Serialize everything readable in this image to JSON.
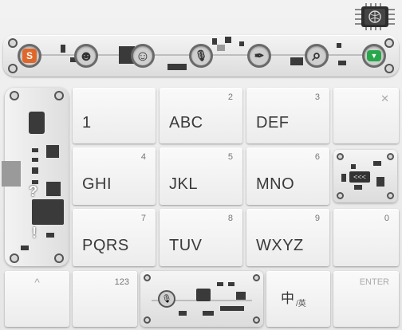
{
  "toolbar": {
    "buttons": [
      {
        "name": "logo",
        "glyph": "S",
        "color": "#e0672a"
      },
      {
        "name": "emoji",
        "glyph": "☻",
        "color": "#3b3b3b"
      },
      {
        "name": "sticker",
        "glyph": "☺",
        "color": "#3b3b3b"
      },
      {
        "name": "voice",
        "glyph": "🎙",
        "color": "#3b3b3b"
      },
      {
        "name": "handwriting",
        "glyph": "✒",
        "color": "#3b3b3b"
      },
      {
        "name": "search",
        "glyph": "⌕",
        "color": "#3b3b3b"
      },
      {
        "name": "collapse",
        "glyph": "▼",
        "color": "#27a84a"
      }
    ]
  },
  "keys": {
    "row1": [
      {
        "main": "1",
        "num": ""
      },
      {
        "main": "ABC",
        "num": "2"
      },
      {
        "main": "DEF",
        "num": "3"
      },
      {
        "main": "",
        "num": "✕"
      }
    ],
    "row2": [
      {
        "main": "GHI",
        "num": "4"
      },
      {
        "main": "JKL",
        "num": "5"
      },
      {
        "main": "MNO",
        "num": "6"
      }
    ],
    "row3": [
      {
        "main": "PQRS",
        "num": "7"
      },
      {
        "main": "TUV",
        "num": "8"
      },
      {
        "main": "WXYZ",
        "num": "9"
      },
      {
        "main": "",
        "num": "0"
      }
    ],
    "bottom": {
      "shift": "^",
      "num123": "123",
      "lang_main": "中",
      "lang_sub": "/英",
      "enter": "ENTER"
    },
    "side_symbols": [
      "?",
      "!"
    ],
    "backspace_icon": "<<<"
  },
  "colors": {
    "accent_orange": "#e0672a",
    "accent_green": "#27a84a"
  }
}
